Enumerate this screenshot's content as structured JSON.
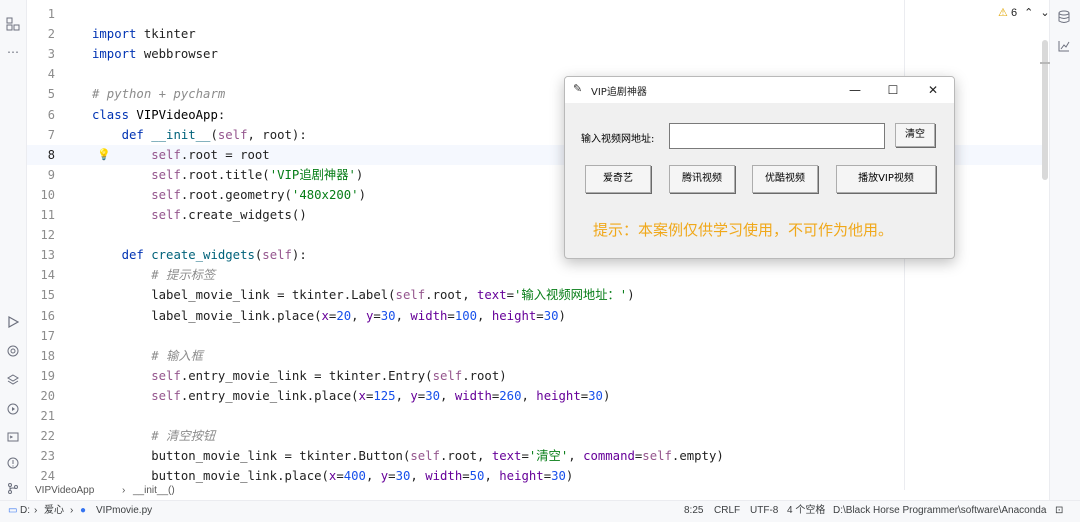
{
  "editor": {
    "line_numbers": [
      "1",
      "2",
      "3",
      "4",
      "5",
      "6",
      "7",
      "8",
      "9",
      "10",
      "11",
      "12",
      "13",
      "14",
      "15",
      "16",
      "17",
      "18",
      "19",
      "20",
      "21",
      "22",
      "23",
      "24"
    ],
    "current_line": "8",
    "warnings_count": "6",
    "lines": [
      [],
      [
        {
          "t": "import",
          "c": "kw"
        },
        {
          "t": " tkinter",
          "c": ""
        }
      ],
      [
        {
          "t": "import",
          "c": "kw"
        },
        {
          "t": " webbrowser",
          "c": ""
        }
      ],
      [],
      [
        {
          "t": "# python + pycharm",
          "c": "cmt"
        }
      ],
      [
        {
          "t": "class ",
          "c": "kw"
        },
        {
          "t": "VIPVideoApp",
          "c": "cls"
        },
        {
          "t": ":",
          "c": ""
        }
      ],
      [
        {
          "t": "    def ",
          "c": "kw"
        },
        {
          "t": "__init__",
          "c": "fn"
        },
        {
          "t": "(",
          "c": ""
        },
        {
          "t": "self",
          "c": "self"
        },
        {
          "t": ", root):",
          "c": ""
        }
      ],
      [
        {
          "t": "        ",
          "c": ""
        },
        {
          "t": "self",
          "c": "self"
        },
        {
          "t": ".root = root",
          "c": ""
        }
      ],
      [
        {
          "t": "        ",
          "c": ""
        },
        {
          "t": "self",
          "c": "self"
        },
        {
          "t": ".root.title(",
          "c": ""
        },
        {
          "t": "'VIP追剧神器'",
          "c": "str"
        },
        {
          "t": ")",
          "c": ""
        }
      ],
      [
        {
          "t": "        ",
          "c": ""
        },
        {
          "t": "self",
          "c": "self"
        },
        {
          "t": ".root.geometry(",
          "c": ""
        },
        {
          "t": "'480x200'",
          "c": "str"
        },
        {
          "t": ")",
          "c": ""
        }
      ],
      [
        {
          "t": "        ",
          "c": ""
        },
        {
          "t": "self",
          "c": "self"
        },
        {
          "t": ".create_widgets()",
          "c": ""
        }
      ],
      [],
      [
        {
          "t": "    def ",
          "c": "kw"
        },
        {
          "t": "create_widgets",
          "c": "fn"
        },
        {
          "t": "(",
          "c": ""
        },
        {
          "t": "self",
          "c": "self"
        },
        {
          "t": "):",
          "c": ""
        }
      ],
      [
        {
          "t": "        # 提示标签",
          "c": "cmt"
        }
      ],
      [
        {
          "t": "        label_movie_link = tkinter.Label(",
          "c": ""
        },
        {
          "t": "self",
          "c": "self"
        },
        {
          "t": ".root, ",
          "c": ""
        },
        {
          "t": "text",
          "c": "arg"
        },
        {
          "t": "=",
          "c": ""
        },
        {
          "t": "'输入视频网地址：'",
          "c": "str"
        },
        {
          "t": ")",
          "c": ""
        }
      ],
      [
        {
          "t": "        label_movie_link.place(",
          "c": ""
        },
        {
          "t": "x",
          "c": "arg"
        },
        {
          "t": "=",
          "c": ""
        },
        {
          "t": "20",
          "c": "num"
        },
        {
          "t": ", ",
          "c": ""
        },
        {
          "t": "y",
          "c": "arg"
        },
        {
          "t": "=",
          "c": ""
        },
        {
          "t": "30",
          "c": "num"
        },
        {
          "t": ", ",
          "c": ""
        },
        {
          "t": "width",
          "c": "arg"
        },
        {
          "t": "=",
          "c": ""
        },
        {
          "t": "100",
          "c": "num"
        },
        {
          "t": ", ",
          "c": ""
        },
        {
          "t": "height",
          "c": "arg"
        },
        {
          "t": "=",
          "c": ""
        },
        {
          "t": "30",
          "c": "num"
        },
        {
          "t": ")",
          "c": ""
        }
      ],
      [],
      [
        {
          "t": "        # 输入框",
          "c": "cmt"
        }
      ],
      [
        {
          "t": "        ",
          "c": ""
        },
        {
          "t": "self",
          "c": "self"
        },
        {
          "t": ".entry_movie_link = tkinter.Entry(",
          "c": ""
        },
        {
          "t": "self",
          "c": "self"
        },
        {
          "t": ".root)",
          "c": ""
        }
      ],
      [
        {
          "t": "        ",
          "c": ""
        },
        {
          "t": "self",
          "c": "self"
        },
        {
          "t": ".entry_movie_link.place(",
          "c": ""
        },
        {
          "t": "x",
          "c": "arg"
        },
        {
          "t": "=",
          "c": ""
        },
        {
          "t": "125",
          "c": "num"
        },
        {
          "t": ", ",
          "c": ""
        },
        {
          "t": "y",
          "c": "arg"
        },
        {
          "t": "=",
          "c": ""
        },
        {
          "t": "30",
          "c": "num"
        },
        {
          "t": ", ",
          "c": ""
        },
        {
          "t": "width",
          "c": "arg"
        },
        {
          "t": "=",
          "c": ""
        },
        {
          "t": "260",
          "c": "num"
        },
        {
          "t": ", ",
          "c": ""
        },
        {
          "t": "height",
          "c": "arg"
        },
        {
          "t": "=",
          "c": ""
        },
        {
          "t": "30",
          "c": "num"
        },
        {
          "t": ")",
          "c": ""
        }
      ],
      [],
      [
        {
          "t": "        # 清空按钮",
          "c": "cmt"
        }
      ],
      [
        {
          "t": "        button_movie_link = tkinter.Button(",
          "c": ""
        },
        {
          "t": "self",
          "c": "self"
        },
        {
          "t": ".root, ",
          "c": ""
        },
        {
          "t": "text",
          "c": "arg"
        },
        {
          "t": "=",
          "c": ""
        },
        {
          "t": "'清空'",
          "c": "str"
        },
        {
          "t": ", ",
          "c": ""
        },
        {
          "t": "command",
          "c": "arg"
        },
        {
          "t": "=",
          "c": ""
        },
        {
          "t": "self",
          "c": "self"
        },
        {
          "t": ".empty)",
          "c": ""
        }
      ],
      [
        {
          "t": "        button_movie_link.place(",
          "c": ""
        },
        {
          "t": "x",
          "c": "arg"
        },
        {
          "t": "=",
          "c": ""
        },
        {
          "t": "400",
          "c": "num"
        },
        {
          "t": ", ",
          "c": ""
        },
        {
          "t": "y",
          "c": "arg"
        },
        {
          "t": "=",
          "c": ""
        },
        {
          "t": "30",
          "c": "num"
        },
        {
          "t": ", ",
          "c": ""
        },
        {
          "t": "width",
          "c": "arg"
        },
        {
          "t": "=",
          "c": ""
        },
        {
          "t": "50",
          "c": "num"
        },
        {
          "t": ", ",
          "c": ""
        },
        {
          "t": "height",
          "c": "arg"
        },
        {
          "t": "=",
          "c": ""
        },
        {
          "t": "30",
          "c": "num"
        },
        {
          "t": ")",
          "c": ""
        }
      ]
    ]
  },
  "breadcrumb": {
    "class": "VIPVideoApp",
    "sep": "›",
    "method": "__init__()"
  },
  "status": {
    "drive": "D:",
    "folder": "爱心",
    "file": "VIPmovie.py",
    "position": "8:25",
    "line_ending": "CRLF",
    "encoding": "UTF-8",
    "indent": "4 个空格",
    "interpreter": "D:\\Black Horse Programmer\\software\\Anaconda"
  },
  "tk_window": {
    "title": "VIP追剧神器",
    "label": "输入视频网地址:",
    "entry_value": "",
    "clear_button": "清空",
    "buttons": [
      "爱奇艺",
      "腾讯视频",
      "优酷视频",
      "播放VIP视频"
    ],
    "hint": "提示：本案例仅供学习使用，不可作为他用。",
    "min_glyph": "—",
    "max_glyph": "☐",
    "close_glyph": "✕"
  },
  "icons": {
    "left": [
      "folder-icon",
      "more-icon",
      "run-icon",
      "python-console-icon",
      "layers-icon",
      "services-icon",
      "terminal-icon",
      "problems-icon",
      "git-icon"
    ],
    "right": [
      "database-icon",
      "chart-icon"
    ]
  },
  "colors": {
    "accent": "#0033b3",
    "hint": "#f0a81a"
  }
}
